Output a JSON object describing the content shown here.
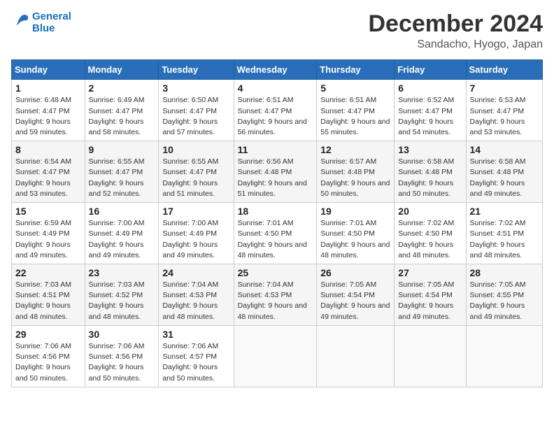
{
  "logo": {
    "line1": "General",
    "line2": "Blue"
  },
  "title": "December 2024",
  "location": "Sandacho, Hyogo, Japan",
  "weekdays": [
    "Sunday",
    "Monday",
    "Tuesday",
    "Wednesday",
    "Thursday",
    "Friday",
    "Saturday"
  ],
  "weeks": [
    [
      {
        "day": "1",
        "rise": "6:48 AM",
        "set": "4:47 PM",
        "daylight": "9 hours and 59 minutes."
      },
      {
        "day": "2",
        "rise": "6:49 AM",
        "set": "4:47 PM",
        "daylight": "9 hours and 58 minutes."
      },
      {
        "day": "3",
        "rise": "6:50 AM",
        "set": "4:47 PM",
        "daylight": "9 hours and 57 minutes."
      },
      {
        "day": "4",
        "rise": "6:51 AM",
        "set": "4:47 PM",
        "daylight": "9 hours and 56 minutes."
      },
      {
        "day": "5",
        "rise": "6:51 AM",
        "set": "4:47 PM",
        "daylight": "9 hours and 55 minutes."
      },
      {
        "day": "6",
        "rise": "6:52 AM",
        "set": "4:47 PM",
        "daylight": "9 hours and 54 minutes."
      },
      {
        "day": "7",
        "rise": "6:53 AM",
        "set": "4:47 PM",
        "daylight": "9 hours and 53 minutes."
      }
    ],
    [
      {
        "day": "8",
        "rise": "6:54 AM",
        "set": "4:47 PM",
        "daylight": "9 hours and 53 minutes."
      },
      {
        "day": "9",
        "rise": "6:55 AM",
        "set": "4:47 PM",
        "daylight": "9 hours and 52 minutes."
      },
      {
        "day": "10",
        "rise": "6:55 AM",
        "set": "4:47 PM",
        "daylight": "9 hours and 51 minutes."
      },
      {
        "day": "11",
        "rise": "6:56 AM",
        "set": "4:48 PM",
        "daylight": "9 hours and 51 minutes."
      },
      {
        "day": "12",
        "rise": "6:57 AM",
        "set": "4:48 PM",
        "daylight": "9 hours and 50 minutes."
      },
      {
        "day": "13",
        "rise": "6:58 AM",
        "set": "4:48 PM",
        "daylight": "9 hours and 50 minutes."
      },
      {
        "day": "14",
        "rise": "6:58 AM",
        "set": "4:48 PM",
        "daylight": "9 hours and 49 minutes."
      }
    ],
    [
      {
        "day": "15",
        "rise": "6:59 AM",
        "set": "4:49 PM",
        "daylight": "9 hours and 49 minutes."
      },
      {
        "day": "16",
        "rise": "7:00 AM",
        "set": "4:49 PM",
        "daylight": "9 hours and 49 minutes."
      },
      {
        "day": "17",
        "rise": "7:00 AM",
        "set": "4:49 PM",
        "daylight": "9 hours and 49 minutes."
      },
      {
        "day": "18",
        "rise": "7:01 AM",
        "set": "4:50 PM",
        "daylight": "9 hours and 48 minutes."
      },
      {
        "day": "19",
        "rise": "7:01 AM",
        "set": "4:50 PM",
        "daylight": "9 hours and 48 minutes."
      },
      {
        "day": "20",
        "rise": "7:02 AM",
        "set": "4:50 PM",
        "daylight": "9 hours and 48 minutes."
      },
      {
        "day": "21",
        "rise": "7:02 AM",
        "set": "4:51 PM",
        "daylight": "9 hours and 48 minutes."
      }
    ],
    [
      {
        "day": "22",
        "rise": "7:03 AM",
        "set": "4:51 PM",
        "daylight": "9 hours and 48 minutes."
      },
      {
        "day": "23",
        "rise": "7:03 AM",
        "set": "4:52 PM",
        "daylight": "9 hours and 48 minutes."
      },
      {
        "day": "24",
        "rise": "7:04 AM",
        "set": "4:53 PM",
        "daylight": "9 hours and 48 minutes."
      },
      {
        "day": "25",
        "rise": "7:04 AM",
        "set": "4:53 PM",
        "daylight": "9 hours and 48 minutes."
      },
      {
        "day": "26",
        "rise": "7:05 AM",
        "set": "4:54 PM",
        "daylight": "9 hours and 49 minutes."
      },
      {
        "day": "27",
        "rise": "7:05 AM",
        "set": "4:54 PM",
        "daylight": "9 hours and 49 minutes."
      },
      {
        "day": "28",
        "rise": "7:05 AM",
        "set": "4:55 PM",
        "daylight": "9 hours and 49 minutes."
      }
    ],
    [
      {
        "day": "29",
        "rise": "7:06 AM",
        "set": "4:56 PM",
        "daylight": "9 hours and 50 minutes."
      },
      {
        "day": "30",
        "rise": "7:06 AM",
        "set": "4:56 PM",
        "daylight": "9 hours and 50 minutes."
      },
      {
        "day": "31",
        "rise": "7:06 AM",
        "set": "4:57 PM",
        "daylight": "9 hours and 50 minutes."
      },
      null,
      null,
      null,
      null
    ]
  ]
}
